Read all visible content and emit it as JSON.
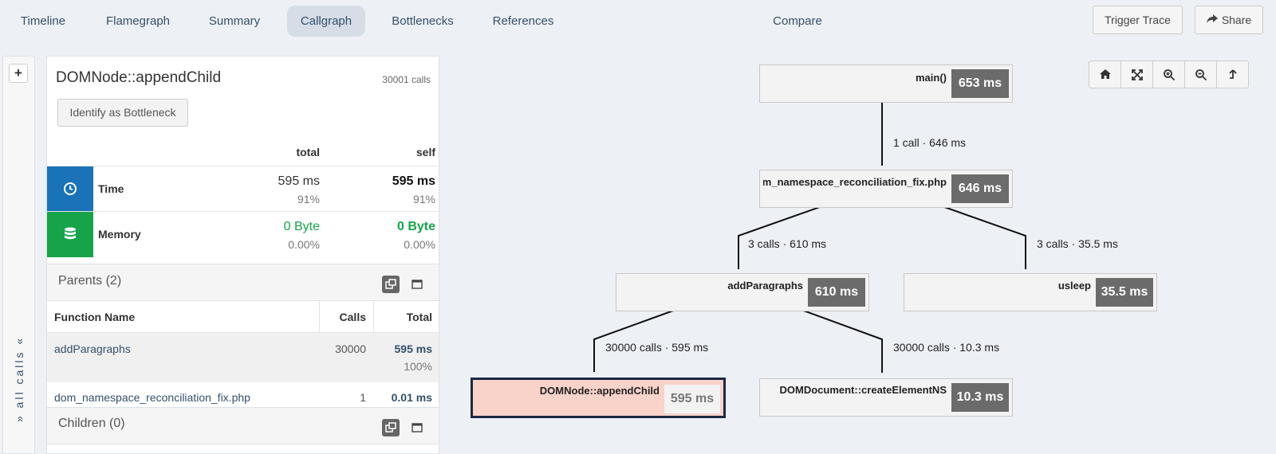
{
  "nav": {
    "tabs": [
      {
        "label": "Timeline"
      },
      {
        "label": "Flamegraph"
      },
      {
        "label": "Summary"
      },
      {
        "label": "Callgraph"
      },
      {
        "label": "Bottlenecks"
      },
      {
        "label": "References"
      },
      {
        "label": "Compare"
      }
    ],
    "active_tab": "Callgraph",
    "trigger_trace_label": "Trigger Trace",
    "share_label": "Share"
  },
  "sidebar": {
    "all_calls_label": "» all calls «"
  },
  "detail": {
    "function_name": "DOMNode::appendChild",
    "calls": "30001 calls",
    "bottleneck_button": "Identify as Bottleneck",
    "col_total": "total",
    "col_self": "self",
    "metrics": [
      {
        "name": "Time",
        "icon": "clock-icon",
        "color": "#1a73b8",
        "total": "595 ms",
        "total_pct": "91%",
        "self": "595 ms",
        "self_pct": "91%"
      },
      {
        "name": "Memory",
        "icon": "database-icon",
        "color": "#16a34a",
        "total": "0 Byte",
        "total_pct": "0.00%",
        "self": "0 Byte",
        "self_pct": "0.00%"
      }
    ],
    "parents": {
      "title": "Parents (2)",
      "columns": [
        "Function Name",
        "Calls",
        "Total"
      ],
      "rows": [
        {
          "name": "addParagraphs",
          "calls": "30000",
          "total": "595 ms",
          "pct": "100%"
        },
        {
          "name": "dom_namespace_reconciliation_fix.php",
          "calls": "1",
          "total": "0.01 ms",
          "pct": ""
        }
      ]
    },
    "children": {
      "title": "Children (0)"
    }
  },
  "graph": {
    "nodes": [
      {
        "id": "main",
        "label": "main()",
        "time": "653 ms"
      },
      {
        "id": "script",
        "label": "m_namespace_reconciliation_fix.php",
        "time": "646 ms"
      },
      {
        "id": "addParagraphs",
        "label": "addParagraphs",
        "time": "610 ms"
      },
      {
        "id": "usleep",
        "label": "usleep",
        "time": "35.5 ms"
      },
      {
        "id": "appendChild",
        "label": "DOMNode::appendChild",
        "time": "595 ms",
        "selected": true
      },
      {
        "id": "createElementNS",
        "label": "DOMDocument::createElementNS",
        "time": "10.3 ms"
      }
    ],
    "edges": [
      {
        "from": "main",
        "to": "script",
        "label": "1 call · 646 ms"
      },
      {
        "from": "script",
        "to": "addParagraphs",
        "label": "3 calls · 610 ms"
      },
      {
        "from": "script",
        "to": "usleep",
        "label": "3 calls · 35.5 ms"
      },
      {
        "from": "addParagraphs",
        "to": "appendChild",
        "label": "30000 calls · 595 ms"
      },
      {
        "from": "addParagraphs",
        "to": "createElementNS",
        "label": "30000 calls · 10.3 ms"
      }
    ],
    "toolbar": [
      "home-icon",
      "fit-icon",
      "zoom-in-icon",
      "zoom-out-icon",
      "up-icon"
    ]
  }
}
